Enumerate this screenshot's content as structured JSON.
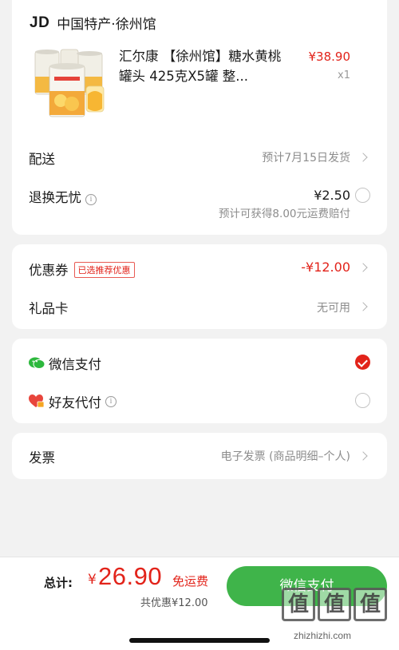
{
  "store": {
    "brand": "JD",
    "name": "中国特产·徐州馆"
  },
  "product": {
    "title": "汇尔康 【徐州馆】糖水黄桃罐头 425克X5罐 整...",
    "price": "¥38.90",
    "qty": "x1",
    "image_icon": "canned-peach-product-image"
  },
  "delivery": {
    "label": "配送",
    "value": "预计7月15日发货"
  },
  "return_insurance": {
    "label": "退换无忧",
    "price": "¥2.50",
    "note": "预计可获得8.00元运费赔付"
  },
  "coupon": {
    "label": "优惠券",
    "badge": "已选推荐优惠",
    "value": "-¥12.00"
  },
  "gift_card": {
    "label": "礼品卡",
    "value": "无可用"
  },
  "payment": {
    "wechat": {
      "label": "微信支付",
      "selected": true
    },
    "friend": {
      "label": "好友代付",
      "selected": false
    }
  },
  "invoice": {
    "label": "发票",
    "value": "电子发票 (商品明细–个人)"
  },
  "footer": {
    "total_label": "总计:",
    "currency": "¥",
    "total": "26.90",
    "shipping": "免运费",
    "saved": "共优惠¥12.00",
    "pay_button": "微信支付"
  },
  "watermark": {
    "logo_chars": [
      "值",
      "值",
      "值"
    ],
    "text": "zhizhizhi.com"
  },
  "colors": {
    "accent_red": "#e2231a",
    "pay_green": "#3fb44a",
    "wechat_green": "#2db83d",
    "background": "#f2f2f2"
  }
}
